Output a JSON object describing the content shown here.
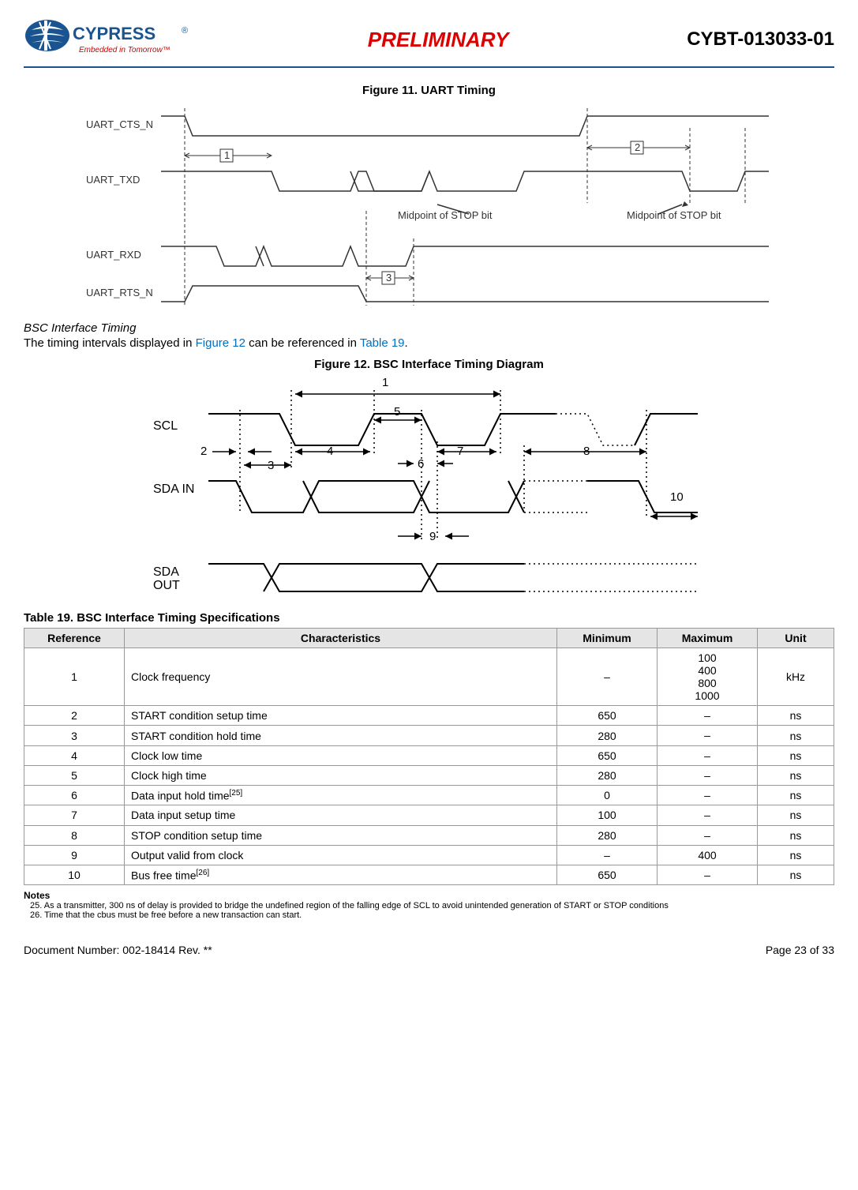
{
  "header": {
    "logo_text": "CYPRESS",
    "logo_tagline": "Embedded in Tomorrow",
    "preliminary": "PRELIMINARY",
    "part_number": "CYBT-013033-01"
  },
  "figure11": {
    "title": "Figure 11.  UART Timing",
    "signals": [
      "UART_CTS_N",
      "UART_TXD",
      "UART_RXD",
      "UART_RTS_N"
    ],
    "annotations": [
      "1",
      "2",
      "3",
      "Midpoint of STOP bit",
      "Midpoint of STOP bit"
    ]
  },
  "section_bsc": {
    "heading": "BSC Interface Timing",
    "text_pre": "The timing intervals displayed in ",
    "link1": "Figure 12",
    "text_mid": " can be referenced in ",
    "link2": "Table 19",
    "text_post": "."
  },
  "figure12": {
    "title": "Figure 12.  BSC Interface Timing Diagram",
    "signals": [
      "SCL",
      "SDA IN",
      "SDA OUT"
    ],
    "markers": [
      "1",
      "2",
      "3",
      "4",
      "5",
      "6",
      "7",
      "8",
      "9",
      "10"
    ]
  },
  "table19": {
    "title": "Table 19.  BSC Interface Timing Specifications",
    "headers": [
      "Reference",
      "Characteristics",
      "Minimum",
      "Maximum",
      "Unit"
    ],
    "rows": [
      {
        "ref": "1",
        "char": "Clock frequency",
        "min": "–",
        "max": "100\n400\n800\n1000",
        "unit": "kHz"
      },
      {
        "ref": "2",
        "char": "START condition setup time",
        "min": "650",
        "max": "–",
        "unit": "ns"
      },
      {
        "ref": "3",
        "char": "START condition hold time",
        "min": "280",
        "max": "–",
        "unit": "ns"
      },
      {
        "ref": "4",
        "char": "Clock low time",
        "min": "650",
        "max": "–",
        "unit": "ns"
      },
      {
        "ref": "5",
        "char": "Clock high time",
        "min": "280",
        "max": "–",
        "unit": "ns"
      },
      {
        "ref": "6",
        "char": "Data input hold time",
        "sup": "[25]",
        "min": "0",
        "max": "–",
        "unit": "ns"
      },
      {
        "ref": "7",
        "char": "Data input setup time",
        "min": "100",
        "max": "–",
        "unit": "ns"
      },
      {
        "ref": "8",
        "char": "STOP condition setup time",
        "min": "280",
        "max": "–",
        "unit": "ns"
      },
      {
        "ref": "9",
        "char": "Output valid from clock",
        "min": "–",
        "max": "400",
        "unit": "ns"
      },
      {
        "ref": "10",
        "char": "Bus free time",
        "sup": "[26]",
        "min": "650",
        "max": "–",
        "unit": "ns"
      }
    ]
  },
  "notes": {
    "title": "Notes",
    "items": [
      "25. As a transmitter, 300 ns of delay is provided to bridge the undefined region of the falling edge of SCL to avoid unintended generation of START or STOP conditions",
      "26. Time that the cbus must be free before a new transaction can start."
    ]
  },
  "footer": {
    "left": "Document Number: 002-18414 Rev. **",
    "right": "Page 23 of 33"
  }
}
